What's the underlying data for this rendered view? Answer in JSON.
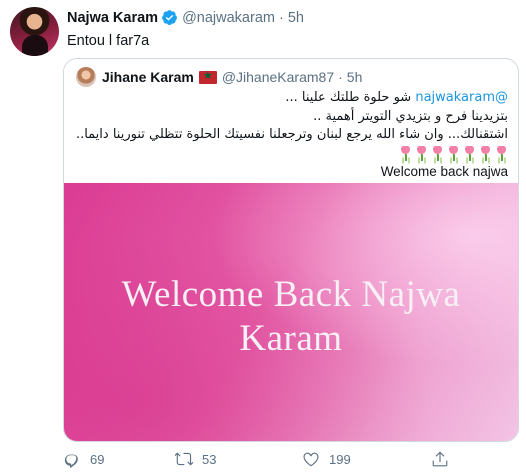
{
  "tweet": {
    "author_name": "Najwa Karam",
    "handle": "@najwakaram",
    "separator": "·",
    "time": "5h",
    "text": "Entou l far7a"
  },
  "quoted_tweet": {
    "author_name": "Jihane Karam",
    "handle": "@JihaneKaram87",
    "separator": "·",
    "time": "5h",
    "mention": "@najwakaram",
    "line1_rest": " شو حلوة طلتك علينا ...",
    "line2": "بتزيدينا فرح و بتزيدي التويتر أهمية ..",
    "line3": "اشتقنالك... وان شاء الله يرجع لبنان وترجعلنا نفسيتك الحلوة تتظلي تنورينا دايما..",
    "emoji_count": 7,
    "emoji_icon": "tulip-icon",
    "closing": "Welcome back najwa",
    "media_title_line1": "Welcome Back Najwa",
    "media_title_line2": "Karam"
  },
  "actions": {
    "reply_count": "69",
    "retweet_count": "53",
    "like_count": "199"
  },
  "colors": {
    "verified": "#1da1f2",
    "secondary_text": "#5b7083",
    "mention": "#1b95e0",
    "media_pink": "#e55fa8"
  }
}
